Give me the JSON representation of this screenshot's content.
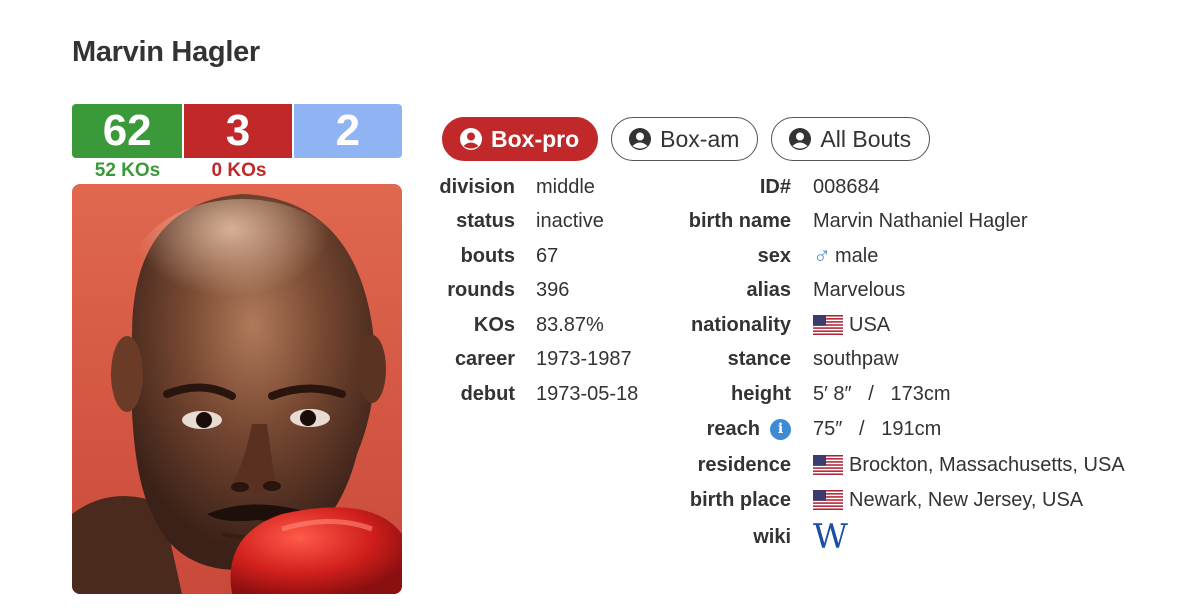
{
  "boxer": {
    "name": "Marvin Hagler"
  },
  "record": {
    "wins": "62",
    "losses": "3",
    "draws": "2",
    "win_kos": "52 KOs",
    "loss_kos": "0 KOs",
    "colors": {
      "wins": "#3a9a3a",
      "losses": "#c0282a",
      "draws": "#8fb3f3"
    }
  },
  "tabs": [
    {
      "label": "Box-pro",
      "icon": "user-circle-icon",
      "active": true
    },
    {
      "label": "Box-am",
      "icon": "user-circle-icon",
      "active": false
    },
    {
      "label": "All Bouts",
      "icon": "user-circle-icon",
      "active": false
    }
  ],
  "left_fields": [
    {
      "label": "division",
      "value": "middle"
    },
    {
      "label": "status",
      "value": "inactive"
    },
    {
      "label": "bouts",
      "value": "67"
    },
    {
      "label": "rounds",
      "value": "396"
    },
    {
      "label": "KOs",
      "value": "83.87%"
    },
    {
      "label": "career",
      "value": "1973-1987"
    },
    {
      "label": "debut",
      "value": "1973-05-18"
    }
  ],
  "right_fields": {
    "id": {
      "label": "ID#",
      "value": "008684"
    },
    "birth_name": {
      "label": "birth name",
      "value": "Marvin Nathaniel Hagler"
    },
    "sex": {
      "label": "sex",
      "value": "male",
      "icon": "male-symbol-icon"
    },
    "alias": {
      "label": "alias",
      "value": "Marvelous"
    },
    "nationality": {
      "label": "nationality",
      "value": "USA",
      "icon": "us-flag-icon"
    },
    "stance": {
      "label": "stance",
      "value": "southpaw"
    },
    "height": {
      "label": "height",
      "value": "5′ 8″   /   173cm"
    },
    "reach": {
      "label": "reach",
      "value": "75″   /   191cm",
      "icon": "info-icon"
    },
    "residence": {
      "label": "residence",
      "value": "Brockton, Massachusetts, USA",
      "icon": "us-flag-icon"
    },
    "birth_place": {
      "label": "birth place",
      "value": "Newark, New Jersey, USA",
      "icon": "us-flag-icon"
    },
    "wiki": {
      "label": "wiki",
      "icon": "wikipedia-icon",
      "glyph": "W"
    }
  },
  "photo": {
    "icon": "boxer-photo",
    "bg": "#e0684f"
  }
}
